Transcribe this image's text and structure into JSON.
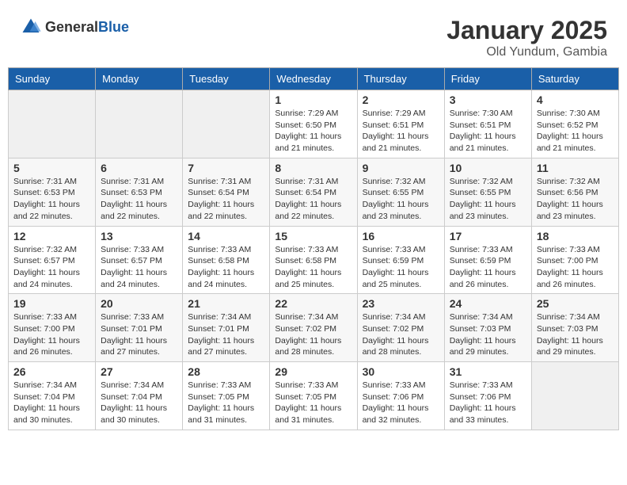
{
  "header": {
    "logo_general": "General",
    "logo_blue": "Blue",
    "month_year": "January 2025",
    "location": "Old Yundum, Gambia"
  },
  "weekdays": [
    "Sunday",
    "Monday",
    "Tuesday",
    "Wednesday",
    "Thursday",
    "Friday",
    "Saturday"
  ],
  "weeks": [
    [
      {
        "day": "",
        "info": ""
      },
      {
        "day": "",
        "info": ""
      },
      {
        "day": "",
        "info": ""
      },
      {
        "day": "1",
        "info": "Sunrise: 7:29 AM\nSunset: 6:50 PM\nDaylight: 11 hours and 21 minutes."
      },
      {
        "day": "2",
        "info": "Sunrise: 7:29 AM\nSunset: 6:51 PM\nDaylight: 11 hours and 21 minutes."
      },
      {
        "day": "3",
        "info": "Sunrise: 7:30 AM\nSunset: 6:51 PM\nDaylight: 11 hours and 21 minutes."
      },
      {
        "day": "4",
        "info": "Sunrise: 7:30 AM\nSunset: 6:52 PM\nDaylight: 11 hours and 21 minutes."
      }
    ],
    [
      {
        "day": "5",
        "info": "Sunrise: 7:31 AM\nSunset: 6:53 PM\nDaylight: 11 hours and 22 minutes."
      },
      {
        "day": "6",
        "info": "Sunrise: 7:31 AM\nSunset: 6:53 PM\nDaylight: 11 hours and 22 minutes."
      },
      {
        "day": "7",
        "info": "Sunrise: 7:31 AM\nSunset: 6:54 PM\nDaylight: 11 hours and 22 minutes."
      },
      {
        "day": "8",
        "info": "Sunrise: 7:31 AM\nSunset: 6:54 PM\nDaylight: 11 hours and 22 minutes."
      },
      {
        "day": "9",
        "info": "Sunrise: 7:32 AM\nSunset: 6:55 PM\nDaylight: 11 hours and 23 minutes."
      },
      {
        "day": "10",
        "info": "Sunrise: 7:32 AM\nSunset: 6:55 PM\nDaylight: 11 hours and 23 minutes."
      },
      {
        "day": "11",
        "info": "Sunrise: 7:32 AM\nSunset: 6:56 PM\nDaylight: 11 hours and 23 minutes."
      }
    ],
    [
      {
        "day": "12",
        "info": "Sunrise: 7:32 AM\nSunset: 6:57 PM\nDaylight: 11 hours and 24 minutes."
      },
      {
        "day": "13",
        "info": "Sunrise: 7:33 AM\nSunset: 6:57 PM\nDaylight: 11 hours and 24 minutes."
      },
      {
        "day": "14",
        "info": "Sunrise: 7:33 AM\nSunset: 6:58 PM\nDaylight: 11 hours and 24 minutes."
      },
      {
        "day": "15",
        "info": "Sunrise: 7:33 AM\nSunset: 6:58 PM\nDaylight: 11 hours and 25 minutes."
      },
      {
        "day": "16",
        "info": "Sunrise: 7:33 AM\nSunset: 6:59 PM\nDaylight: 11 hours and 25 minutes."
      },
      {
        "day": "17",
        "info": "Sunrise: 7:33 AM\nSunset: 6:59 PM\nDaylight: 11 hours and 26 minutes."
      },
      {
        "day": "18",
        "info": "Sunrise: 7:33 AM\nSunset: 7:00 PM\nDaylight: 11 hours and 26 minutes."
      }
    ],
    [
      {
        "day": "19",
        "info": "Sunrise: 7:33 AM\nSunset: 7:00 PM\nDaylight: 11 hours and 26 minutes."
      },
      {
        "day": "20",
        "info": "Sunrise: 7:33 AM\nSunset: 7:01 PM\nDaylight: 11 hours and 27 minutes."
      },
      {
        "day": "21",
        "info": "Sunrise: 7:34 AM\nSunset: 7:01 PM\nDaylight: 11 hours and 27 minutes."
      },
      {
        "day": "22",
        "info": "Sunrise: 7:34 AM\nSunset: 7:02 PM\nDaylight: 11 hours and 28 minutes."
      },
      {
        "day": "23",
        "info": "Sunrise: 7:34 AM\nSunset: 7:02 PM\nDaylight: 11 hours and 28 minutes."
      },
      {
        "day": "24",
        "info": "Sunrise: 7:34 AM\nSunset: 7:03 PM\nDaylight: 11 hours and 29 minutes."
      },
      {
        "day": "25",
        "info": "Sunrise: 7:34 AM\nSunset: 7:03 PM\nDaylight: 11 hours and 29 minutes."
      }
    ],
    [
      {
        "day": "26",
        "info": "Sunrise: 7:34 AM\nSunset: 7:04 PM\nDaylight: 11 hours and 30 minutes."
      },
      {
        "day": "27",
        "info": "Sunrise: 7:34 AM\nSunset: 7:04 PM\nDaylight: 11 hours and 30 minutes."
      },
      {
        "day": "28",
        "info": "Sunrise: 7:33 AM\nSunset: 7:05 PM\nDaylight: 11 hours and 31 minutes."
      },
      {
        "day": "29",
        "info": "Sunrise: 7:33 AM\nSunset: 7:05 PM\nDaylight: 11 hours and 31 minutes."
      },
      {
        "day": "30",
        "info": "Sunrise: 7:33 AM\nSunset: 7:06 PM\nDaylight: 11 hours and 32 minutes."
      },
      {
        "day": "31",
        "info": "Sunrise: 7:33 AM\nSunset: 7:06 PM\nDaylight: 11 hours and 33 minutes."
      },
      {
        "day": "",
        "info": ""
      }
    ]
  ]
}
